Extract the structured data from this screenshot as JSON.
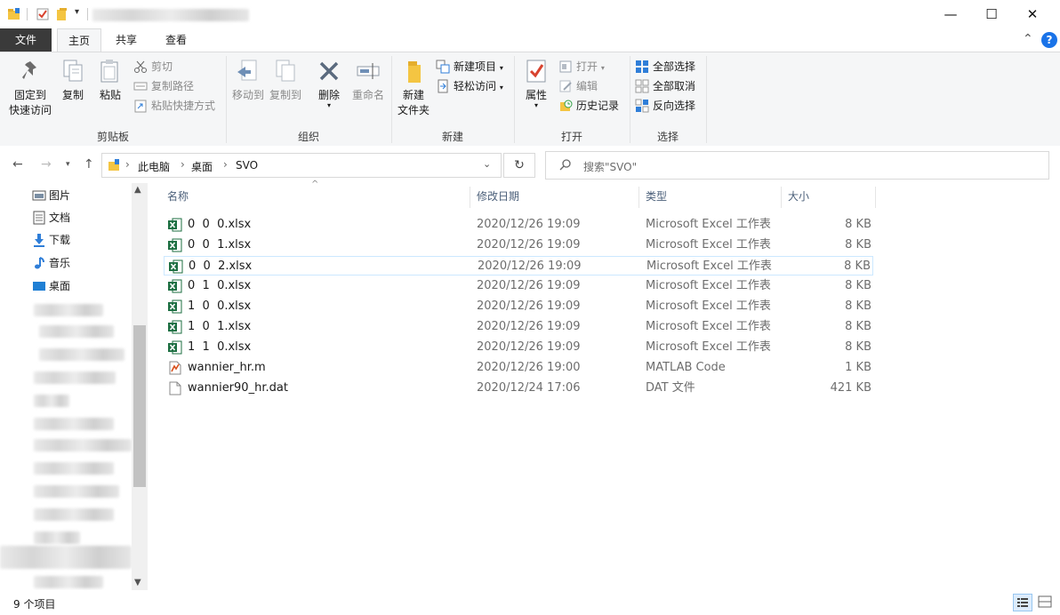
{
  "window": {
    "minimize_glyph": "—",
    "maximize_glyph": "☐",
    "close_glyph": "✕"
  },
  "tabs": [
    {
      "label": "文件"
    },
    {
      "label": "主页"
    },
    {
      "label": "共享"
    },
    {
      "label": "查看"
    }
  ],
  "help_glyph": "?",
  "collapse_glyph": "⌃",
  "ribbon": {
    "clipboard": {
      "pin_label_1": "固定到",
      "pin_label_2": "快速访问",
      "copy": "复制",
      "paste": "粘贴",
      "cut": "剪切",
      "copy_path": "复制路径",
      "paste_shortcut": "粘贴快捷方式",
      "group": "剪贴板"
    },
    "organize": {
      "move_to": "移动到",
      "copy_to": "复制到",
      "delete": "删除",
      "rename": "重命名",
      "group": "组织"
    },
    "new": {
      "new_folder_1": "新建",
      "new_folder_2": "文件夹",
      "new_item": "新建项目",
      "easy_access": "轻松访问",
      "group": "新建"
    },
    "open": {
      "properties": "属性",
      "open": "打开",
      "edit": "编辑",
      "history": "历史记录",
      "group": "打开"
    },
    "select": {
      "select_all": "全部选择",
      "select_none": "全部取消",
      "invert": "反向选择",
      "group": "选择"
    }
  },
  "nav": {
    "back": "←",
    "forward": "→",
    "up": "↑",
    "breadcrumb": [
      "此电脑",
      "桌面",
      "SVO"
    ],
    "sep": "›",
    "refresh": "↻",
    "search_placeholder": "搜索\"SVO\""
  },
  "sidebar": {
    "items": [
      {
        "label": "图片"
      },
      {
        "label": "文档"
      },
      {
        "label": "下载"
      },
      {
        "label": "音乐"
      },
      {
        "label": "桌面"
      }
    ]
  },
  "columns": {
    "name": "名称",
    "date": "修改日期",
    "type": "类型",
    "size": "大小"
  },
  "files": [
    {
      "name": "0  0  0.xlsx",
      "date": "2020/12/26 19:09",
      "type": "Microsoft Excel 工作表",
      "size": "8 KB",
      "icon": "excel-icon"
    },
    {
      "name": "0  0  1.xlsx",
      "date": "2020/12/26 19:09",
      "type": "Microsoft Excel 工作表",
      "size": "8 KB",
      "icon": "excel-icon"
    },
    {
      "name": "0  0  2.xlsx",
      "date": "2020/12/26 19:09",
      "type": "Microsoft Excel 工作表",
      "size": "8 KB",
      "icon": "excel-icon"
    },
    {
      "name": "0  1  0.xlsx",
      "date": "2020/12/26 19:09",
      "type": "Microsoft Excel 工作表",
      "size": "8 KB",
      "icon": "excel-icon"
    },
    {
      "name": "1  0  0.xlsx",
      "date": "2020/12/26 19:09",
      "type": "Microsoft Excel 工作表",
      "size": "8 KB",
      "icon": "excel-icon"
    },
    {
      "name": "1  0  1.xlsx",
      "date": "2020/12/26 19:09",
      "type": "Microsoft Excel 工作表",
      "size": "8 KB",
      "icon": "excel-icon"
    },
    {
      "name": "1  1  0.xlsx",
      "date": "2020/12/26 19:09",
      "type": "Microsoft Excel 工作表",
      "size": "8 KB",
      "icon": "excel-icon"
    },
    {
      "name": "wannier_hr.m",
      "date": "2020/12/26 19:00",
      "type": "MATLAB Code",
      "size": "1 KB",
      "icon": "matlab-file-icon"
    },
    {
      "name": "wannier90_hr.dat",
      "date": "2020/12/24 17:06",
      "type": "DAT 文件",
      "size": "421 KB",
      "icon": "blank-file-icon"
    }
  ],
  "status": {
    "count": "9 个项目"
  },
  "colors": {
    "excel_green": "#1d6f42",
    "file_tab": "#3a3a3a",
    "help_blue": "#1a73e8",
    "select_border": "#cce8ff"
  }
}
